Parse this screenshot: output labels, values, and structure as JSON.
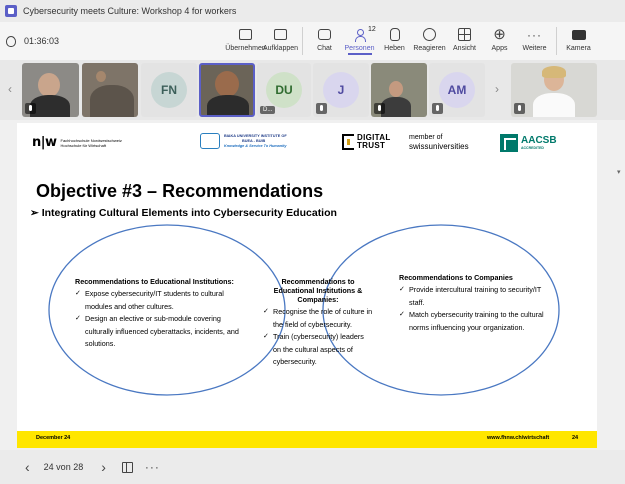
{
  "window": {
    "title": "Cybersecurity meets Culture: Workshop 4 for workers"
  },
  "meeting": {
    "timer": "01:36:03",
    "toolbar": [
      {
        "key": "share",
        "label": "Übernehmen",
        "icon": "share-screen-icon"
      },
      {
        "key": "popout",
        "label": "Aufklappen",
        "icon": "pop-out-icon"
      },
      {
        "key": "chat",
        "label": "Chat",
        "icon": "chat-icon"
      },
      {
        "key": "people",
        "label": "Personen",
        "icon": "people-icon",
        "count": "12",
        "active": true
      },
      {
        "key": "raise",
        "label": "Heben",
        "icon": "raise-hand-icon"
      },
      {
        "key": "react",
        "label": "Reagieren",
        "icon": "react-icon"
      },
      {
        "key": "view",
        "label": "Ansicht",
        "icon": "view-grid-icon"
      },
      {
        "key": "apps",
        "label": "Apps",
        "icon": "apps-plus-icon"
      },
      {
        "key": "more",
        "label": "Weitere",
        "icon": "more-icon"
      },
      {
        "key": "camera",
        "label": "Kamera",
        "icon": "camera-icon"
      }
    ]
  },
  "participants": [
    {
      "type": "video",
      "muted": true
    },
    {
      "type": "video",
      "muted": false
    },
    {
      "type": "avatar",
      "initials": "FN",
      "color": "#c7d6d4",
      "text_color": "#3c5f5a"
    },
    {
      "type": "video",
      "selected": true,
      "muted": false
    },
    {
      "type": "avatar",
      "initials": "DU",
      "color": "#cfe1c8",
      "text_color": "#2f6b2f",
      "name": "D..."
    },
    {
      "type": "avatar",
      "initials": "J",
      "color": "#d9d6ee",
      "text_color": "#4f4aa0",
      "muted": true
    },
    {
      "type": "video",
      "muted": true
    },
    {
      "type": "avatar",
      "initials": "AM",
      "color": "#d9d6ee",
      "text_color": "#4f4aa0",
      "muted": true
    },
    {
      "type": "video",
      "muted": true
    }
  ],
  "slide": {
    "logos": {
      "fhnw_mark": "n|w",
      "fhnw_line1": "Fachhochschule Nordwestschweiz",
      "fhnw_line2": "Hochschule für Wirtschaft",
      "biaka_line1": "BIAKA UNIVERSITY INSTITUTE OF",
      "biaka_line2": "BUEA - BUIB",
      "biaka_line3": "Knowledge & Service To Humanity",
      "dtrust_line1": "DIGITAL",
      "dtrust_line2": "TRUST",
      "swiss_line1": "member of",
      "swiss_line2": "swissuniversities",
      "aacsb_name": "AACSB",
      "aacsb_sub": "ACCREDITED"
    },
    "title": "Objective #3 – Recommendations",
    "subtitle": "➢ Integrating Cultural Elements into Cybersecurity Education",
    "left": {
      "heading": "Recommendations to Educational Institutions:",
      "items": [
        "Expose cybersecurity/IT students to cultural modules and other cultures.",
        "Design an elective or sub-module covering culturally influenced cyberattacks, incidents, and solutions."
      ]
    },
    "center": {
      "heading": "Recommendations to Educational Institutions & Companies:",
      "items": [
        "Recognise the role of culture in the field of cybersecurity.",
        "Train (cybersecurity) leaders on the cultural aspects of cybersecurity."
      ]
    },
    "right": {
      "heading": "Recommendations to Companies",
      "items": [
        "Provide intercultural training to security/IT staff.",
        "Match cybersecurity training to the cultural norms influencing your organization."
      ]
    },
    "footer": {
      "date": "December 24",
      "url": "www.fhnw.ch/wirtschaft",
      "number": "24"
    },
    "colors": {
      "footer_bar": "#ffe600",
      "circle_stroke": "#4a78c2"
    }
  },
  "controls": {
    "page": "24 von 28"
  }
}
